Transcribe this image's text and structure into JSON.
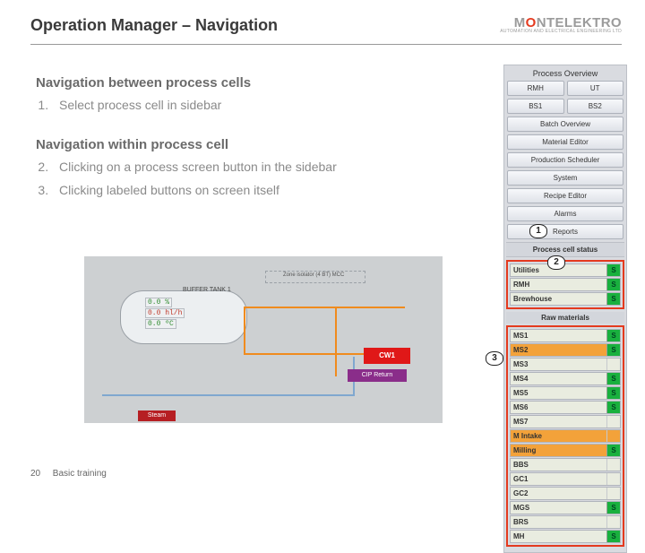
{
  "header": {
    "title": "Operation Manager – Navigation",
    "brand_pre": "M",
    "brand_o": "O",
    "brand_post": "NTELEKTRO",
    "brand_tag": "AUTOMATION  AND  ELECTRICAL  ENGINEERING  LTD"
  },
  "sections": {
    "nav_between": "Navigation between process cells",
    "nav_within": "Navigation within process cell"
  },
  "steps": {
    "s1": "Select process cell in sidebar",
    "s2": "Clicking on a process screen button in the sidebar",
    "s3": "Clicking labeled buttons on screen itself"
  },
  "markers": {
    "m1": "1",
    "m2": "2",
    "m3": "3"
  },
  "diagram": {
    "buffer_label": "BUFFER TANK 1",
    "read_a": "0.0 %",
    "read_b": "0.0 hl/h",
    "read_c": "0.0 ºC",
    "zone_label": "Zone isolator (4 BT) MCC",
    "cw1": "CW1",
    "cip": "CIP Return",
    "steam": "Steam"
  },
  "sidebar": {
    "overview": "Process Overview",
    "tabs": {
      "a": "RMH",
      "b": "UT",
      "c": "BS1",
      "d": "BS2"
    },
    "menu": {
      "batch": "Batch Overview",
      "material": "Material Editor",
      "scheduler": "Production Scheduler",
      "system": "System",
      "recipe": "Recipe Editor",
      "alarms": "Alarms",
      "reports": "Reports"
    },
    "pcstatus_hdr": "Process cell status",
    "pcstatus": [
      {
        "name": "Utilities",
        "s": "S"
      },
      {
        "name": "RMH",
        "s": "S"
      },
      {
        "name": "Brewhouse",
        "s": "S"
      }
    ],
    "raw_hdr": "Raw materials",
    "raw": [
      {
        "name": "MS1",
        "s": "S",
        "sel": false
      },
      {
        "name": "MS2",
        "s": "S",
        "sel": true
      },
      {
        "name": "MS3",
        "s": "",
        "sel": false
      },
      {
        "name": "MS4",
        "s": "S",
        "sel": false
      },
      {
        "name": "MS5",
        "s": "S",
        "sel": false
      },
      {
        "name": "MS6",
        "s": "S",
        "sel": false
      },
      {
        "name": "MS7",
        "s": "",
        "sel": false
      },
      {
        "name": "M Intake",
        "s": "",
        "sel": true
      },
      {
        "name": "Milling",
        "s": "S",
        "sel": true
      },
      {
        "name": "BBS",
        "s": "",
        "sel": false
      },
      {
        "name": "GC1",
        "s": "",
        "sel": false
      },
      {
        "name": "GC2",
        "s": "",
        "sel": false
      },
      {
        "name": "MGS",
        "s": "S",
        "sel": false
      },
      {
        "name": "BRS",
        "s": "",
        "sel": false
      },
      {
        "name": "MH",
        "s": "S",
        "sel": false
      }
    ]
  },
  "footer": {
    "page": "20",
    "label": "Basic training"
  }
}
